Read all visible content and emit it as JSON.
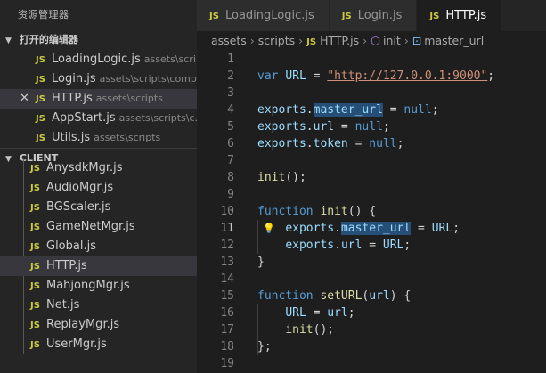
{
  "sidebar": {
    "title": "资源管理器",
    "open_editors": {
      "header": "打开的编辑器",
      "items": [
        {
          "icon": "JS",
          "name": "LoadingLogic.js",
          "path": "assets\\scri..."
        },
        {
          "icon": "JS",
          "name": "Login.js",
          "path": "assets\\scripts\\comp..."
        },
        {
          "icon": "JS",
          "name": "HTTP.js",
          "path": "assets\\scripts",
          "close": "✕"
        },
        {
          "icon": "JS",
          "name": "AppStart.js",
          "path": "assets\\scripts\\c..."
        },
        {
          "icon": "JS",
          "name": "Utils.js",
          "path": "assets\\scripts"
        }
      ]
    },
    "client": {
      "header": "CLIENT",
      "items": [
        {
          "icon": "JS",
          "name": "AnysdkMgr.js"
        },
        {
          "icon": "JS",
          "name": "AudioMgr.js"
        },
        {
          "icon": "JS",
          "name": "BGScaler.js"
        },
        {
          "icon": "JS",
          "name": "GameNetMgr.js"
        },
        {
          "icon": "JS",
          "name": "Global.js"
        },
        {
          "icon": "JS",
          "name": "HTTP.js"
        },
        {
          "icon": "JS",
          "name": "MahjongMgr.js"
        },
        {
          "icon": "JS",
          "name": "Net.js"
        },
        {
          "icon": "JS",
          "name": "ReplayMgr.js"
        },
        {
          "icon": "JS",
          "name": "UserMgr.js"
        }
      ]
    }
  },
  "tabs": [
    {
      "icon": "JS",
      "label": "LoadingLogic.js"
    },
    {
      "icon": "JS",
      "label": "Login.js"
    },
    {
      "icon": "JS",
      "label": "HTTP.js"
    }
  ],
  "breadcrumb": {
    "parts": [
      "assets",
      "scripts"
    ],
    "file_icon": "JS",
    "file": "HTTP.js",
    "func": "init",
    "field": "master_url"
  },
  "code": {
    "current_line": "11",
    "lines": [
      {
        "n": "1",
        "tokens": []
      },
      {
        "n": "2",
        "tokens": [
          {
            "t": "var ",
            "c": "kw"
          },
          {
            "t": "URL",
            "c": "var"
          },
          {
            "t": " = ",
            "c": "op"
          },
          {
            "t": "\"http://127.0.0.1:9000\"",
            "c": "str"
          },
          {
            "t": ";",
            "c": "op"
          }
        ]
      },
      {
        "n": "3",
        "tokens": []
      },
      {
        "n": "4",
        "tokens": [
          {
            "t": "exports",
            "c": "var"
          },
          {
            "t": ".",
            "c": "op"
          },
          {
            "t": "master_url",
            "c": "var hl"
          },
          {
            "t": " = ",
            "c": "op"
          },
          {
            "t": "null",
            "c": "kw"
          },
          {
            "t": ";",
            "c": "op"
          }
        ]
      },
      {
        "n": "5",
        "tokens": [
          {
            "t": "exports",
            "c": "var"
          },
          {
            "t": ".",
            "c": "op"
          },
          {
            "t": "url",
            "c": "var"
          },
          {
            "t": " = ",
            "c": "op"
          },
          {
            "t": "null",
            "c": "kw"
          },
          {
            "t": ";",
            "c": "op"
          }
        ]
      },
      {
        "n": "6",
        "tokens": [
          {
            "t": "exports",
            "c": "var"
          },
          {
            "t": ".",
            "c": "op"
          },
          {
            "t": "token",
            "c": "var"
          },
          {
            "t": " = ",
            "c": "op"
          },
          {
            "t": "null",
            "c": "kw"
          },
          {
            "t": ";",
            "c": "op"
          }
        ]
      },
      {
        "n": "7",
        "tokens": []
      },
      {
        "n": "8",
        "tokens": [
          {
            "t": "init",
            "c": "fn"
          },
          {
            "t": "();",
            "c": "op"
          }
        ]
      },
      {
        "n": "9",
        "tokens": []
      },
      {
        "n": "10",
        "tokens": [
          {
            "t": "function ",
            "c": "kw"
          },
          {
            "t": "init",
            "c": "fn"
          },
          {
            "t": "() {",
            "c": "op"
          }
        ]
      },
      {
        "n": "11",
        "tokens": [
          {
            "t": "    ",
            "c": "op"
          },
          {
            "t": "exports",
            "c": "var"
          },
          {
            "t": ".",
            "c": "op"
          },
          {
            "t": "master_url",
            "c": "var hl"
          },
          {
            "t": " = ",
            "c": "op"
          },
          {
            "t": "URL",
            "c": "var"
          },
          {
            "t": ";",
            "c": "op"
          }
        ]
      },
      {
        "n": "12",
        "tokens": [
          {
            "t": "    ",
            "c": "op"
          },
          {
            "t": "exports",
            "c": "var"
          },
          {
            "t": ".",
            "c": "op"
          },
          {
            "t": "url",
            "c": "var"
          },
          {
            "t": " = ",
            "c": "op"
          },
          {
            "t": "URL",
            "c": "var"
          },
          {
            "t": ";",
            "c": "op"
          }
        ]
      },
      {
        "n": "13",
        "tokens": [
          {
            "t": "}",
            "c": "op"
          }
        ]
      },
      {
        "n": "14",
        "tokens": []
      },
      {
        "n": "15",
        "tokens": [
          {
            "t": "function ",
            "c": "kw"
          },
          {
            "t": "setURL",
            "c": "fn"
          },
          {
            "t": "(",
            "c": "op"
          },
          {
            "t": "url",
            "c": "var"
          },
          {
            "t": ") {",
            "c": "op"
          }
        ]
      },
      {
        "n": "16",
        "tokens": [
          {
            "t": "    ",
            "c": "op"
          },
          {
            "t": "URL",
            "c": "var"
          },
          {
            "t": " = ",
            "c": "op"
          },
          {
            "t": "url",
            "c": "var"
          },
          {
            "t": ";",
            "c": "op"
          }
        ]
      },
      {
        "n": "17",
        "tokens": [
          {
            "t": "    ",
            "c": "op"
          },
          {
            "t": "init",
            "c": "fn"
          },
          {
            "t": "();",
            "c": "op"
          }
        ]
      },
      {
        "n": "18",
        "tokens": [
          {
            "t": "};",
            "c": "op"
          }
        ]
      },
      {
        "n": "19",
        "tokens": []
      }
    ]
  },
  "colors": {
    "accent": "#264f78",
    "js_icon": "#cbcb41",
    "keyword": "#569cd6",
    "function": "#dcdcaa",
    "variable": "#9cdcfe",
    "string": "#ce9178"
  }
}
